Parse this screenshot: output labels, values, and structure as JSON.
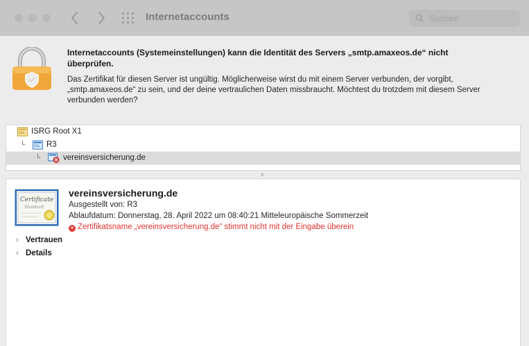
{
  "window": {
    "title": "Internetaccounts",
    "search_placeholder": "Suchen"
  },
  "message": {
    "title": "Internetaccounts (Systemeinstellungen) kann die Identität des Servers „smtp.amaxeos.de“ nicht überprüfen.",
    "body": "Das Zertifikat für diesen Server ist ungültig. Möglicherweise wirst du mit einem Server verbunden, der vorgibt, „smtp.amaxeos.de“ zu sein, und der deine vertraulichen Daten missbraucht. Möchtest du trotzdem mit diesem Server verbunden werden?"
  },
  "chain": [
    {
      "label": "ISRG Root X1",
      "level": 0,
      "icon": "root-cert-icon",
      "selected": false
    },
    {
      "label": "R3",
      "level": 1,
      "icon": "intermediate-cert-icon",
      "selected": false
    },
    {
      "label": "vereinsversicherung.de",
      "level": 2,
      "icon": "invalid-cert-icon",
      "selected": true
    }
  ],
  "details": {
    "name": "vereinsversicherung.de",
    "issuer": "Ausgestellt von: R3",
    "expiry": "Ablaufdatum: Donnerstag, 28. April 2022 um 08:40:21 Mitteleuropäische Sommerzeit",
    "error": "Zertifikatsname „vereinsversicherung.de“ stimmt nicht mit der Eingabe überein",
    "cert_image_text_1": "Certificate",
    "cert_image_text_2": "Standard",
    "sections": [
      "Vertrauen",
      "Details"
    ]
  },
  "colors": {
    "error": "#e0332e",
    "selection": "#dcdcdc",
    "titlebar": "#c6c6c6"
  }
}
